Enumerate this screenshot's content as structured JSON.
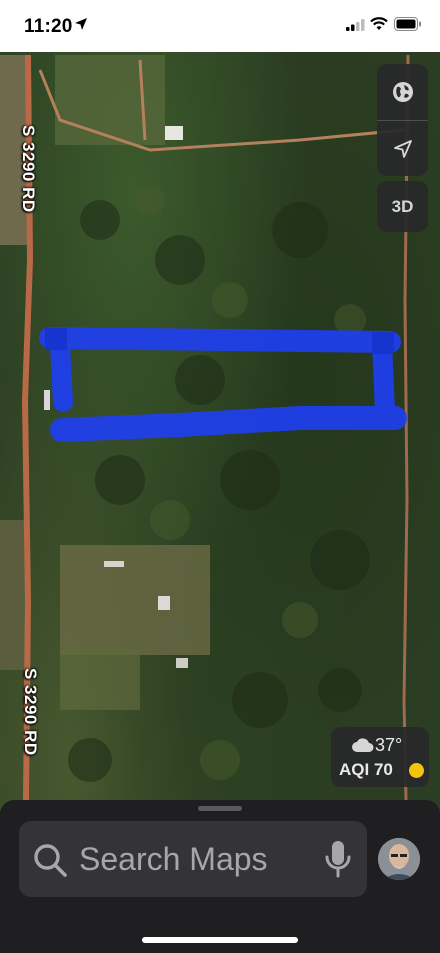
{
  "status_bar": {
    "time": "11:20",
    "icons": [
      "location-arrow-icon",
      "cellular-signal-icon",
      "wifi-icon",
      "battery-icon"
    ]
  },
  "map": {
    "road_label_top": "S 3290 RD",
    "road_label_bottom": "S 3290 RD",
    "outline_color": "#1f3ff0"
  },
  "controls": {
    "globe_icon": "globe-icon",
    "location_icon": "location-arrow-icon",
    "three_d_label": "3D"
  },
  "weather": {
    "temperature": "37°",
    "aqi": "AQI 70",
    "condition_icon": "cloud-icon",
    "aqi_color": "#f2c40f"
  },
  "search": {
    "placeholder": "Search Maps",
    "icons": [
      "search-icon",
      "microphone-icon"
    ]
  },
  "profile": {
    "icon": "profile-avatar"
  }
}
